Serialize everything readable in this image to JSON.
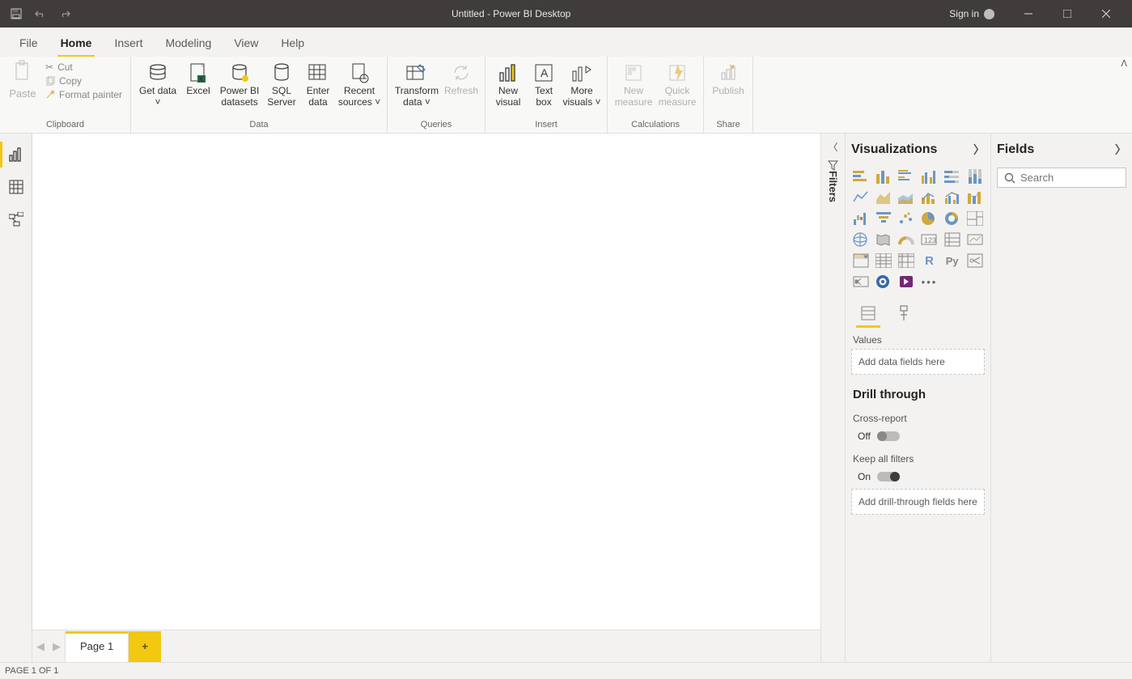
{
  "titlebar": {
    "title": "Untitled - Power BI Desktop",
    "signin": "Sign in"
  },
  "tabs": {
    "file": "File",
    "home": "Home",
    "insert": "Insert",
    "modeling": "Modeling",
    "view": "View",
    "help": "Help"
  },
  "ribbon": {
    "clipboard": {
      "label": "Clipboard",
      "paste": "Paste",
      "cut": "Cut",
      "copy": "Copy",
      "format_painter": "Format painter"
    },
    "data": {
      "label": "Data",
      "get_data": "Get data",
      "excel": "Excel",
      "pbi_datasets": "Power BI datasets",
      "sql_server": "SQL Server",
      "enter_data": "Enter data",
      "recent_sources": "Recent sources"
    },
    "queries": {
      "label": "Queries",
      "transform": "Transform data",
      "refresh": "Refresh"
    },
    "insert": {
      "label": "Insert",
      "new_visual": "New visual",
      "text_box": "Text box",
      "more_visuals": "More visuals"
    },
    "calculations": {
      "label": "Calculations",
      "new_measure": "New measure",
      "quick_measure": "Quick measure"
    },
    "share": {
      "label": "Share",
      "publish": "Publish"
    }
  },
  "leftrail": {
    "report": "Report",
    "data": "Data",
    "model": "Model"
  },
  "pages": {
    "prev": "Previous",
    "next": "Next",
    "page1": "Page 1",
    "add": "+"
  },
  "filters_rail": {
    "label": "Filters"
  },
  "viz_pane": {
    "title": "Visualizations",
    "values_label": "Values",
    "values_placeholder": "Add data fields here",
    "drill_title": "Drill through",
    "cross_report_label": "Cross-report",
    "cross_report_state": "Off",
    "keep_filters_label": "Keep all filters",
    "keep_filters_state": "On",
    "drill_placeholder": "Add drill-through fields here"
  },
  "fields_pane": {
    "title": "Fields",
    "search_placeholder": "Search"
  },
  "statusbar": {
    "text": "PAGE 1 OF 1"
  }
}
